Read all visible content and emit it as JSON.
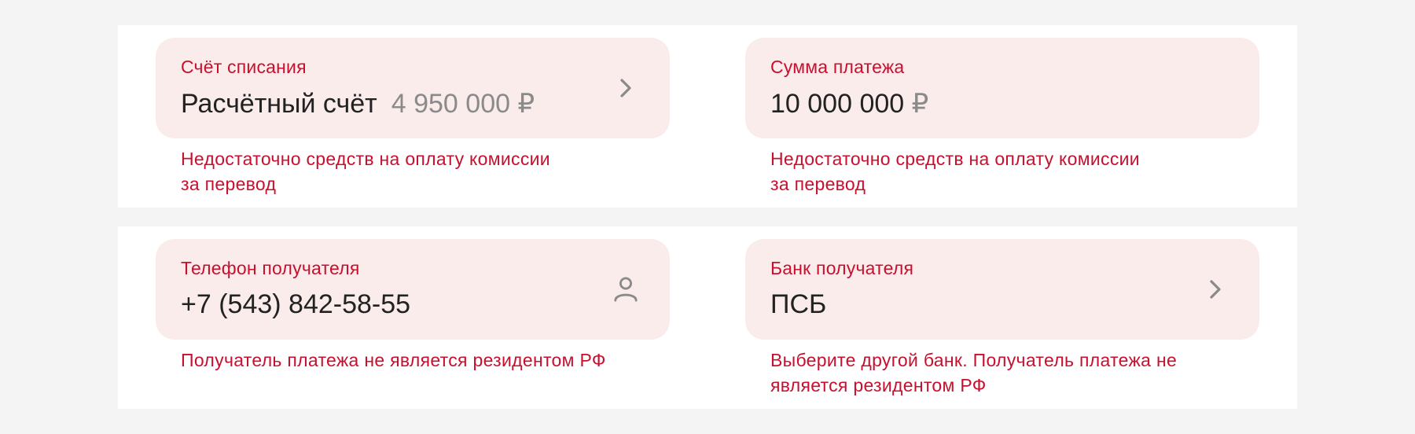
{
  "colors": {
    "accent_red": "#c8102e",
    "field_bg": "#fbecec",
    "muted": "#8a8a8a",
    "text": "#222222",
    "page_bg": "#f4f4f4"
  },
  "account": {
    "label": "Счёт списания",
    "value": "Расчётный счёт",
    "balance": "4 950 000",
    "currency": "₽",
    "error": "Недостаточно средств на оплату комиссии\nза перевод",
    "trailing_icon": "chevron-right-icon"
  },
  "amount": {
    "label": "Сумма платежа",
    "value": "10 000 000",
    "currency": "₽",
    "error": "Недостаточно средств на оплату комиссии\nза перевод"
  },
  "phone": {
    "label": "Телефон получателя",
    "value": "+7 (543) 842-58-55",
    "error": "Получатель платежа не является резидентом РФ",
    "trailing_icon": "contact-person-icon"
  },
  "bank": {
    "label": "Банк получателя",
    "value": "ПСБ",
    "error": "Выберите другой банк. Получатель платежа не\nявляется резидентом РФ",
    "trailing_icon": "chevron-right-icon"
  }
}
